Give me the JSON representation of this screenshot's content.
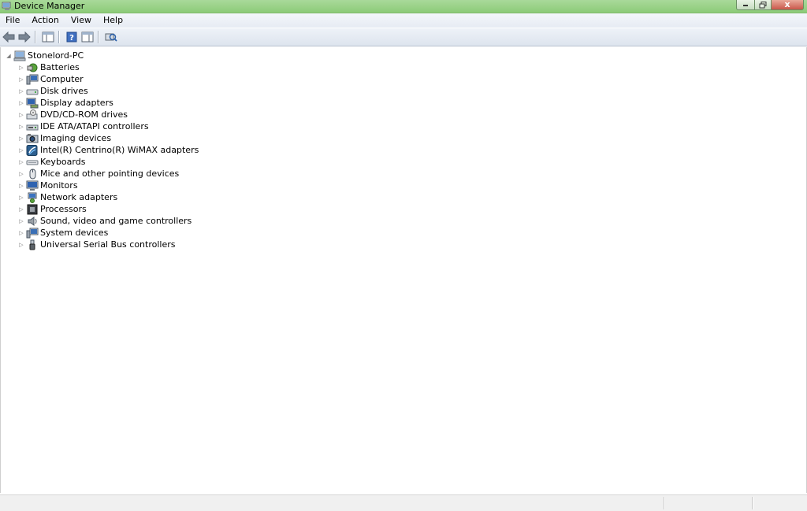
{
  "window": {
    "title": "Device Manager",
    "close_glyph": "x"
  },
  "menu": [
    "File",
    "Action",
    "View",
    "Help"
  ],
  "toolbar": {
    "buttons": [
      "back-arrow-icon",
      "forward-arrow-icon",
      "show-hide-console-tree-icon",
      "help-icon",
      "properties-pane-icon",
      "scan-hardware-icon"
    ]
  },
  "tree": {
    "root": {
      "label": "Stonelord-PC",
      "icon": "computer-root-icon",
      "expanded": true
    },
    "items": [
      {
        "label": "Batteries",
        "icon": "battery-icon"
      },
      {
        "label": "Computer",
        "icon": "computer-icon"
      },
      {
        "label": "Disk drives",
        "icon": "disk-drive-icon"
      },
      {
        "label": "Display adapters",
        "icon": "display-adapter-icon"
      },
      {
        "label": "DVD/CD-ROM drives",
        "icon": "dvd-drive-icon"
      },
      {
        "label": "IDE ATA/ATAPI controllers",
        "icon": "ide-controller-icon"
      },
      {
        "label": "Imaging devices",
        "icon": "imaging-device-icon"
      },
      {
        "label": "Intel(R) Centrino(R) WiMAX adapters",
        "icon": "wimax-adapter-icon"
      },
      {
        "label": "Keyboards",
        "icon": "keyboard-icon"
      },
      {
        "label": "Mice and other pointing devices",
        "icon": "mouse-icon"
      },
      {
        "label": "Monitors",
        "icon": "monitor-icon"
      },
      {
        "label": "Network adapters",
        "icon": "network-adapter-icon"
      },
      {
        "label": "Processors",
        "icon": "processor-icon"
      },
      {
        "label": "Sound, video and game controllers",
        "icon": "sound-icon"
      },
      {
        "label": "System devices",
        "icon": "system-device-icon"
      },
      {
        "label": "Universal Serial Bus controllers",
        "icon": "usb-icon"
      }
    ]
  },
  "colors": {
    "titlebar": "#8ccb78",
    "menubar": "#eef2f8",
    "background": "#ffffff"
  }
}
